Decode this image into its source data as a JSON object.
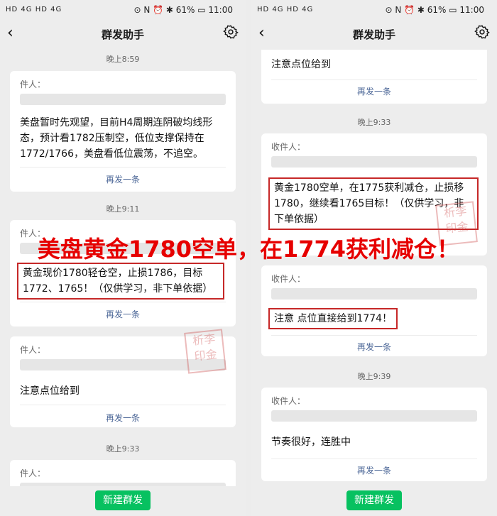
{
  "left": {
    "status": {
      "signals": "HD 4G HD 4G",
      "right": "⊙ N ⏰ ✱ 61% ▭ 11:00"
    },
    "nav": {
      "back": "‹",
      "title": "群发助手"
    },
    "items": [
      {
        "time": "晚上8:59",
        "recv": "件人：",
        "msg": "美盘暂时先观望，目前H4周期连阴破均线形态，预计看1782压制空，低位支撑保持在1772/1766，美盘看低位震荡，不追空。",
        "resend": "再发一条"
      },
      {
        "time": "晚上9:11",
        "recv": "件人：",
        "msg": "黄金现价1780轻仓空，止损1786，目标1772、1765！（仅供学习，非下单依据）",
        "resend": "再发一条"
      },
      {
        "time": "",
        "recv": "件人：",
        "msg": "注意点位给到",
        "resend": "再发一条"
      },
      {
        "time": "晚上9:33",
        "recv": "件人："
      }
    ],
    "button": "新建群发"
  },
  "right": {
    "status": {
      "signals": "HD 4G HD 4G",
      "right": "⊙ N ⏰ ✱ 61% ▭ 11:00"
    },
    "nav": {
      "back": "‹",
      "title": "群发助手"
    },
    "items": [
      {
        "msg": "注意点位给到",
        "resend": "再发一条"
      },
      {
        "time": "晚上9:33",
        "recv": "收件人：",
        "msg": "黄金1780空单，在1775获利减仓，止损移1780，继续看1765目标！（仅供学习，非下单依据）",
        "resend": ""
      },
      {
        "recv": "收件人：",
        "msg": "注意 点位直接给到1774！",
        "resend": "再发一条"
      },
      {
        "time": "晚上9:39",
        "recv": "收件人：",
        "msg": "节奏很好，连胜中",
        "resend": "再发一条"
      }
    ],
    "button": "新建群发"
  },
  "banner": "美盘黄金1780空单，在1774获利减仓！",
  "seal": "析李印金",
  "colors": {
    "accent": "#07c160",
    "link": "#4a6596",
    "highlight": "#c62828",
    "banner": "#e60000"
  }
}
